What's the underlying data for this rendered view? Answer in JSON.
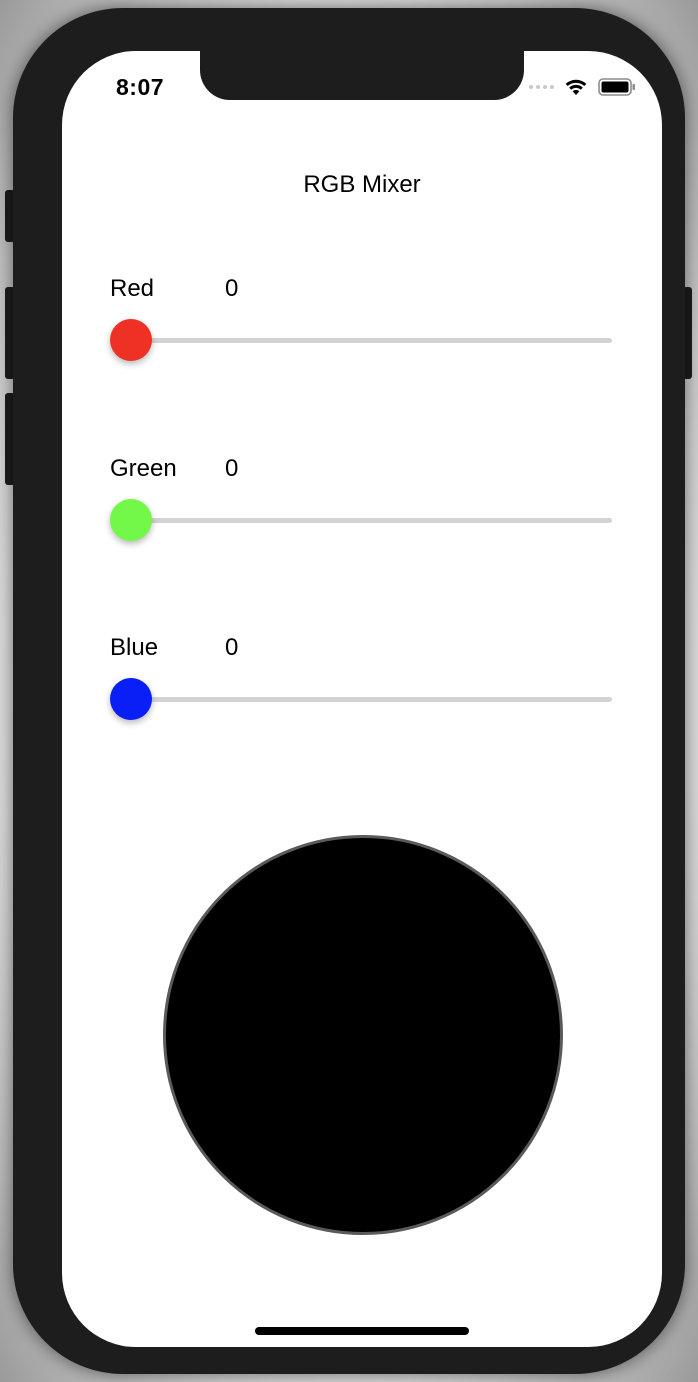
{
  "status_bar": {
    "time": "8:07",
    "icons": [
      "cellular-signal-icon",
      "wifi-icon",
      "battery-icon"
    ]
  },
  "app": {
    "title": "RGB Mixer"
  },
  "sliders": [
    {
      "label": "Red",
      "value": "0",
      "level": 0,
      "thumb_color": "#ee3124"
    },
    {
      "label": "Green",
      "value": "0",
      "level": 0,
      "thumb_color": "#73f84a"
    },
    {
      "label": "Blue",
      "value": "0",
      "level": 0,
      "thumb_color": "#0a1ff5"
    }
  ],
  "preview": {
    "fill_color": "#000000",
    "border_color": "#5a5a5a"
  },
  "colors": {
    "track": "#d3d3d6",
    "background": "#ffffff",
    "device_frame": "#1d1d1d"
  }
}
